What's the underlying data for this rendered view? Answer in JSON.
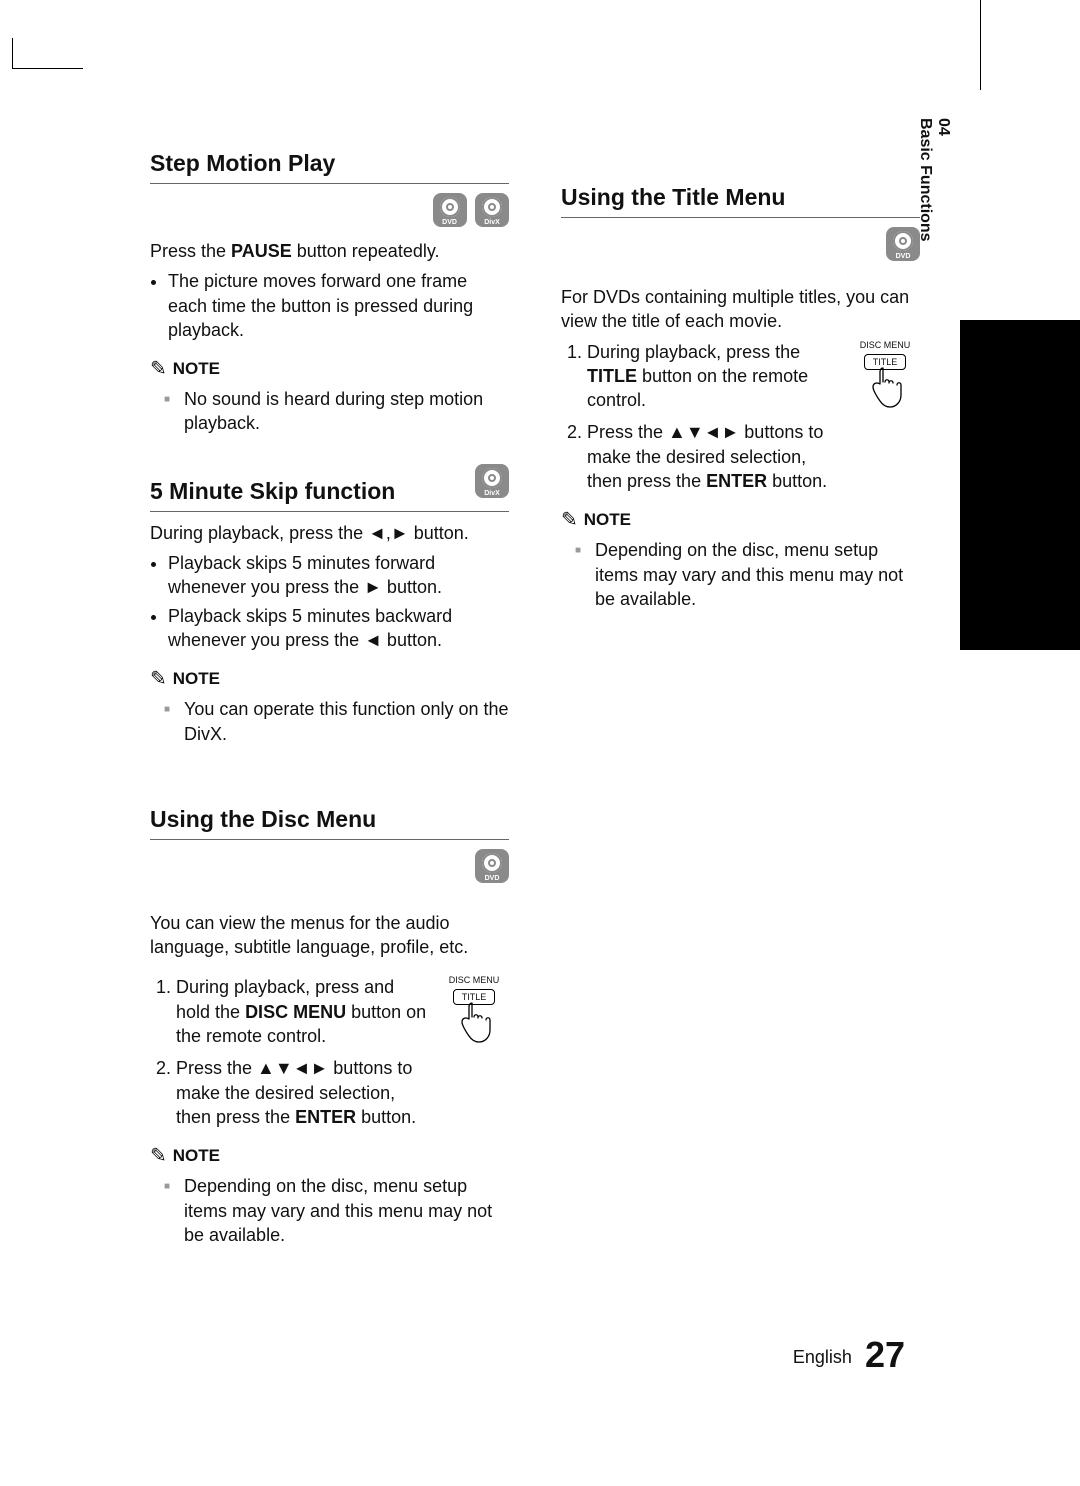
{
  "side": {
    "chapter": "04",
    "title": "Basic Functions"
  },
  "footer": {
    "lang": "English",
    "page": "27"
  },
  "badges": {
    "dvd": "DVD",
    "divx": "DivX"
  },
  "noteLabel": "NOTE",
  "remote": {
    "top": "DISC MENU",
    "btn": "TITLE"
  },
  "stepMotion": {
    "title": "Step Motion Play",
    "intro_pre": "Press the ",
    "intro_bold": "PAUSE",
    "intro_post": " button repeatedly.",
    "bullet1": "The picture moves forward one frame each time the button is pressed during playback.",
    "note1": "No sound is heard during step motion playback."
  },
  "skip": {
    "title": "5 Minute Skip function",
    "intro": "During playback, press the ◄,► button.",
    "b1": "Playback skips 5 minutes forward whenever you press the ► button.",
    "b2": "Playback skips 5 minutes backward whenever you press the ◄ button.",
    "note1": "You can operate this function only on the DivX."
  },
  "discMenu": {
    "title": "Using the Disc Menu",
    "intro": "You can view the menus for the audio language, subtitle language, profile, etc.",
    "s1_pre": "During playback, press and hold the ",
    "s1_bold": "DISC MENU",
    "s1_post": " button on the remote control.",
    "s2_pre": "Press the ▲▼◄► buttons to make the desired selection, then press the ",
    "s2_bold": "ENTER",
    "s2_post": " button.",
    "note1": "Depending on the disc, menu setup items may vary and this menu may not be available."
  },
  "titleMenu": {
    "title": "Using the Title Menu",
    "intro": "For DVDs containing multiple titles, you can view the title of each movie.",
    "s1_pre": "During playback, press the ",
    "s1_bold": "TITLE",
    "s1_post": " button on the remote control.",
    "s2_pre": "Press the ▲▼◄► buttons to make the desired selection, then press the ",
    "s2_bold": "ENTER",
    "s2_post": " button.",
    "note1": "Depending on the disc, menu setup items may vary and this menu may not be available."
  }
}
